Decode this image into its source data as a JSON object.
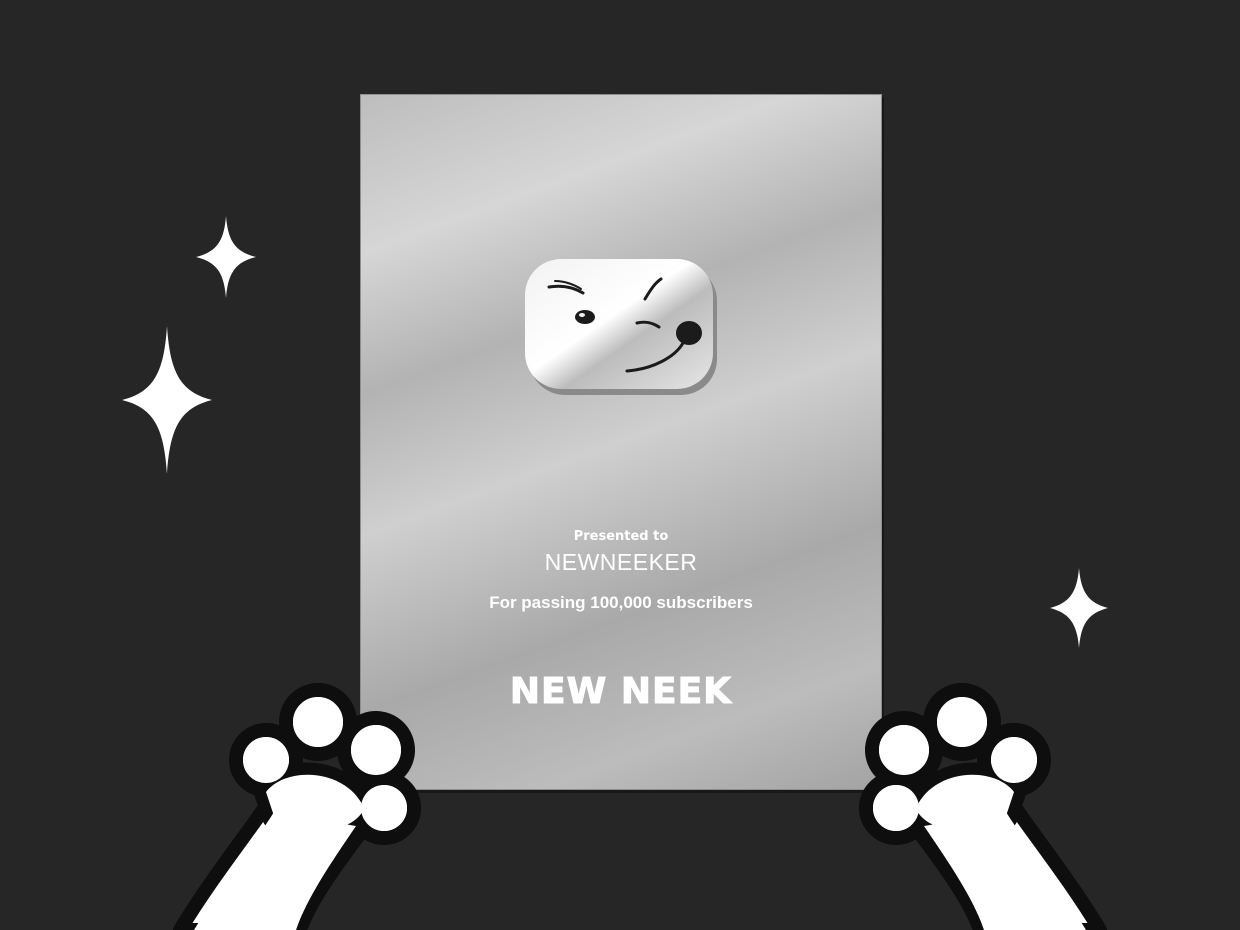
{
  "plaque": {
    "presented_label": "Presented to",
    "recipient": "NEWNEEKER",
    "milestone": "For passing 100,000 subscribers",
    "brand": "NEW NEEK"
  },
  "colors": {
    "background": "#262626",
    "plaque_silver": "#bdbdbd",
    "text": "#ffffff",
    "outline": "#111111"
  }
}
